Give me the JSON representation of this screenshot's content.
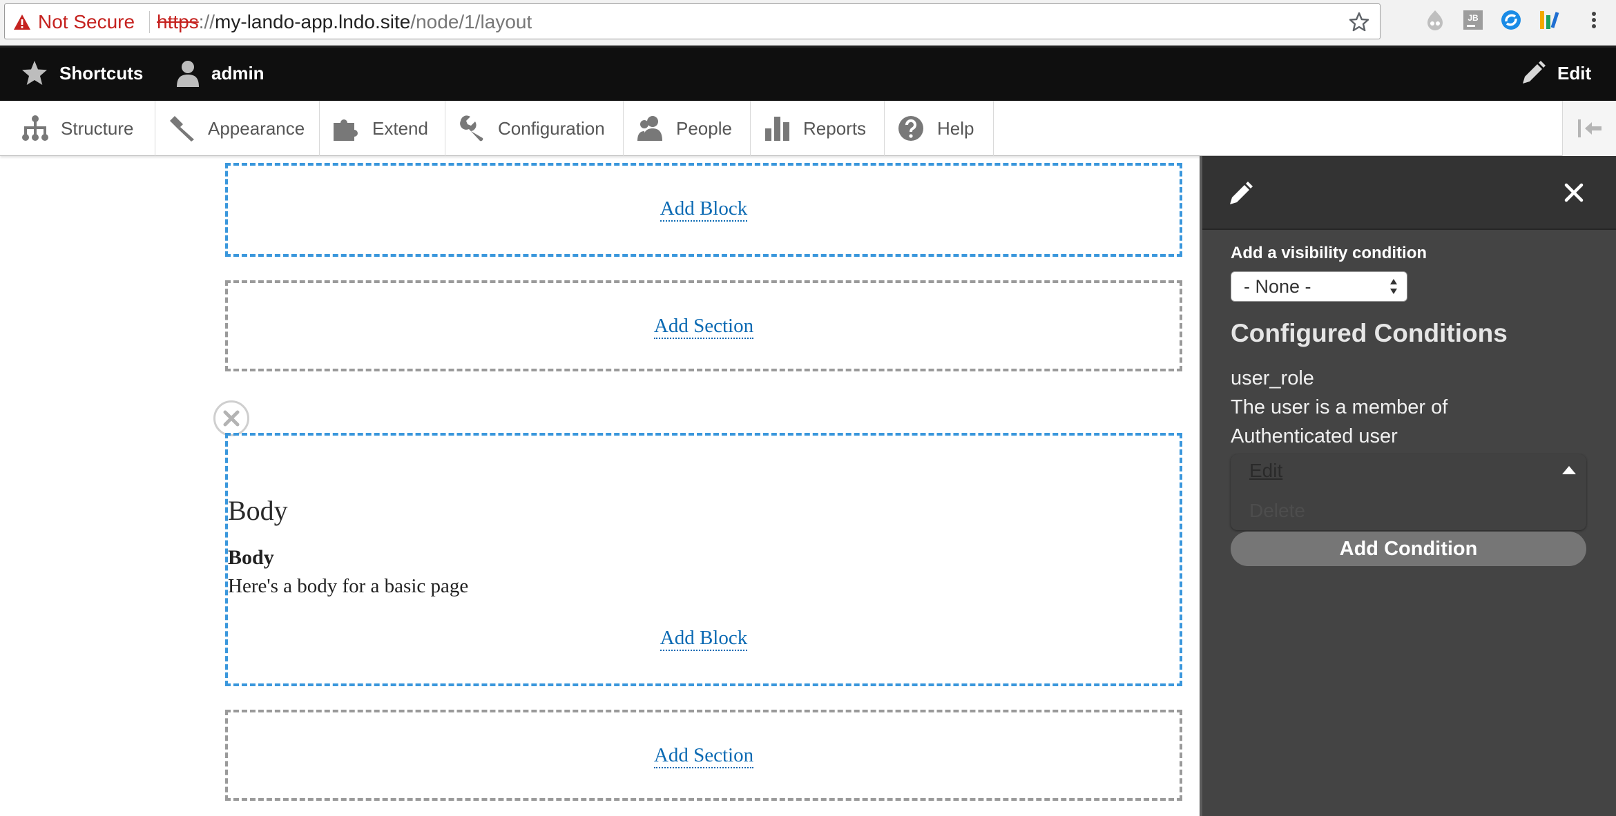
{
  "browser": {
    "security_text": "Not Secure",
    "url_scheme": "https",
    "url_punct": "://",
    "url_host": "my-lando-app.lndo.site",
    "url_path": "/node/1/layout"
  },
  "toolbar": {
    "shortcuts_label": "Shortcuts",
    "user_label": "admin",
    "edit_label": "Edit",
    "tray_items": [
      {
        "label": "Structure",
        "icon": "structure-icon"
      },
      {
        "label": "Appearance",
        "icon": "appearance-icon"
      },
      {
        "label": "Extend",
        "icon": "extend-icon"
      },
      {
        "label": "Configuration",
        "icon": "configuration-icon"
      },
      {
        "label": "People",
        "icon": "people-icon"
      },
      {
        "label": "Reports",
        "icon": "reports-icon"
      },
      {
        "label": "Help",
        "icon": "help-icon"
      }
    ]
  },
  "layout": {
    "add_block_label": "Add Block",
    "add_section_label": "Add Section",
    "body_heading": "Body",
    "body_field_label": "Body",
    "body_field_text": "Here's a body for a basic page"
  },
  "off_canvas": {
    "visibility_label": "Add a visibility condition",
    "select_value": "- None -",
    "configured_heading": "Configured Conditions",
    "condition_id": "user_role",
    "condition_summary_1": "The user is a member of",
    "condition_summary_2": "Authenticated user",
    "edit_label": "Edit",
    "delete_label": "Delete",
    "add_condition_label": "Add Condition"
  },
  "colors": {
    "link": "#0b6ab3",
    "region_border": "#3a97dc",
    "insecure": "#c5221f",
    "off_canvas_bg": "#444444"
  }
}
